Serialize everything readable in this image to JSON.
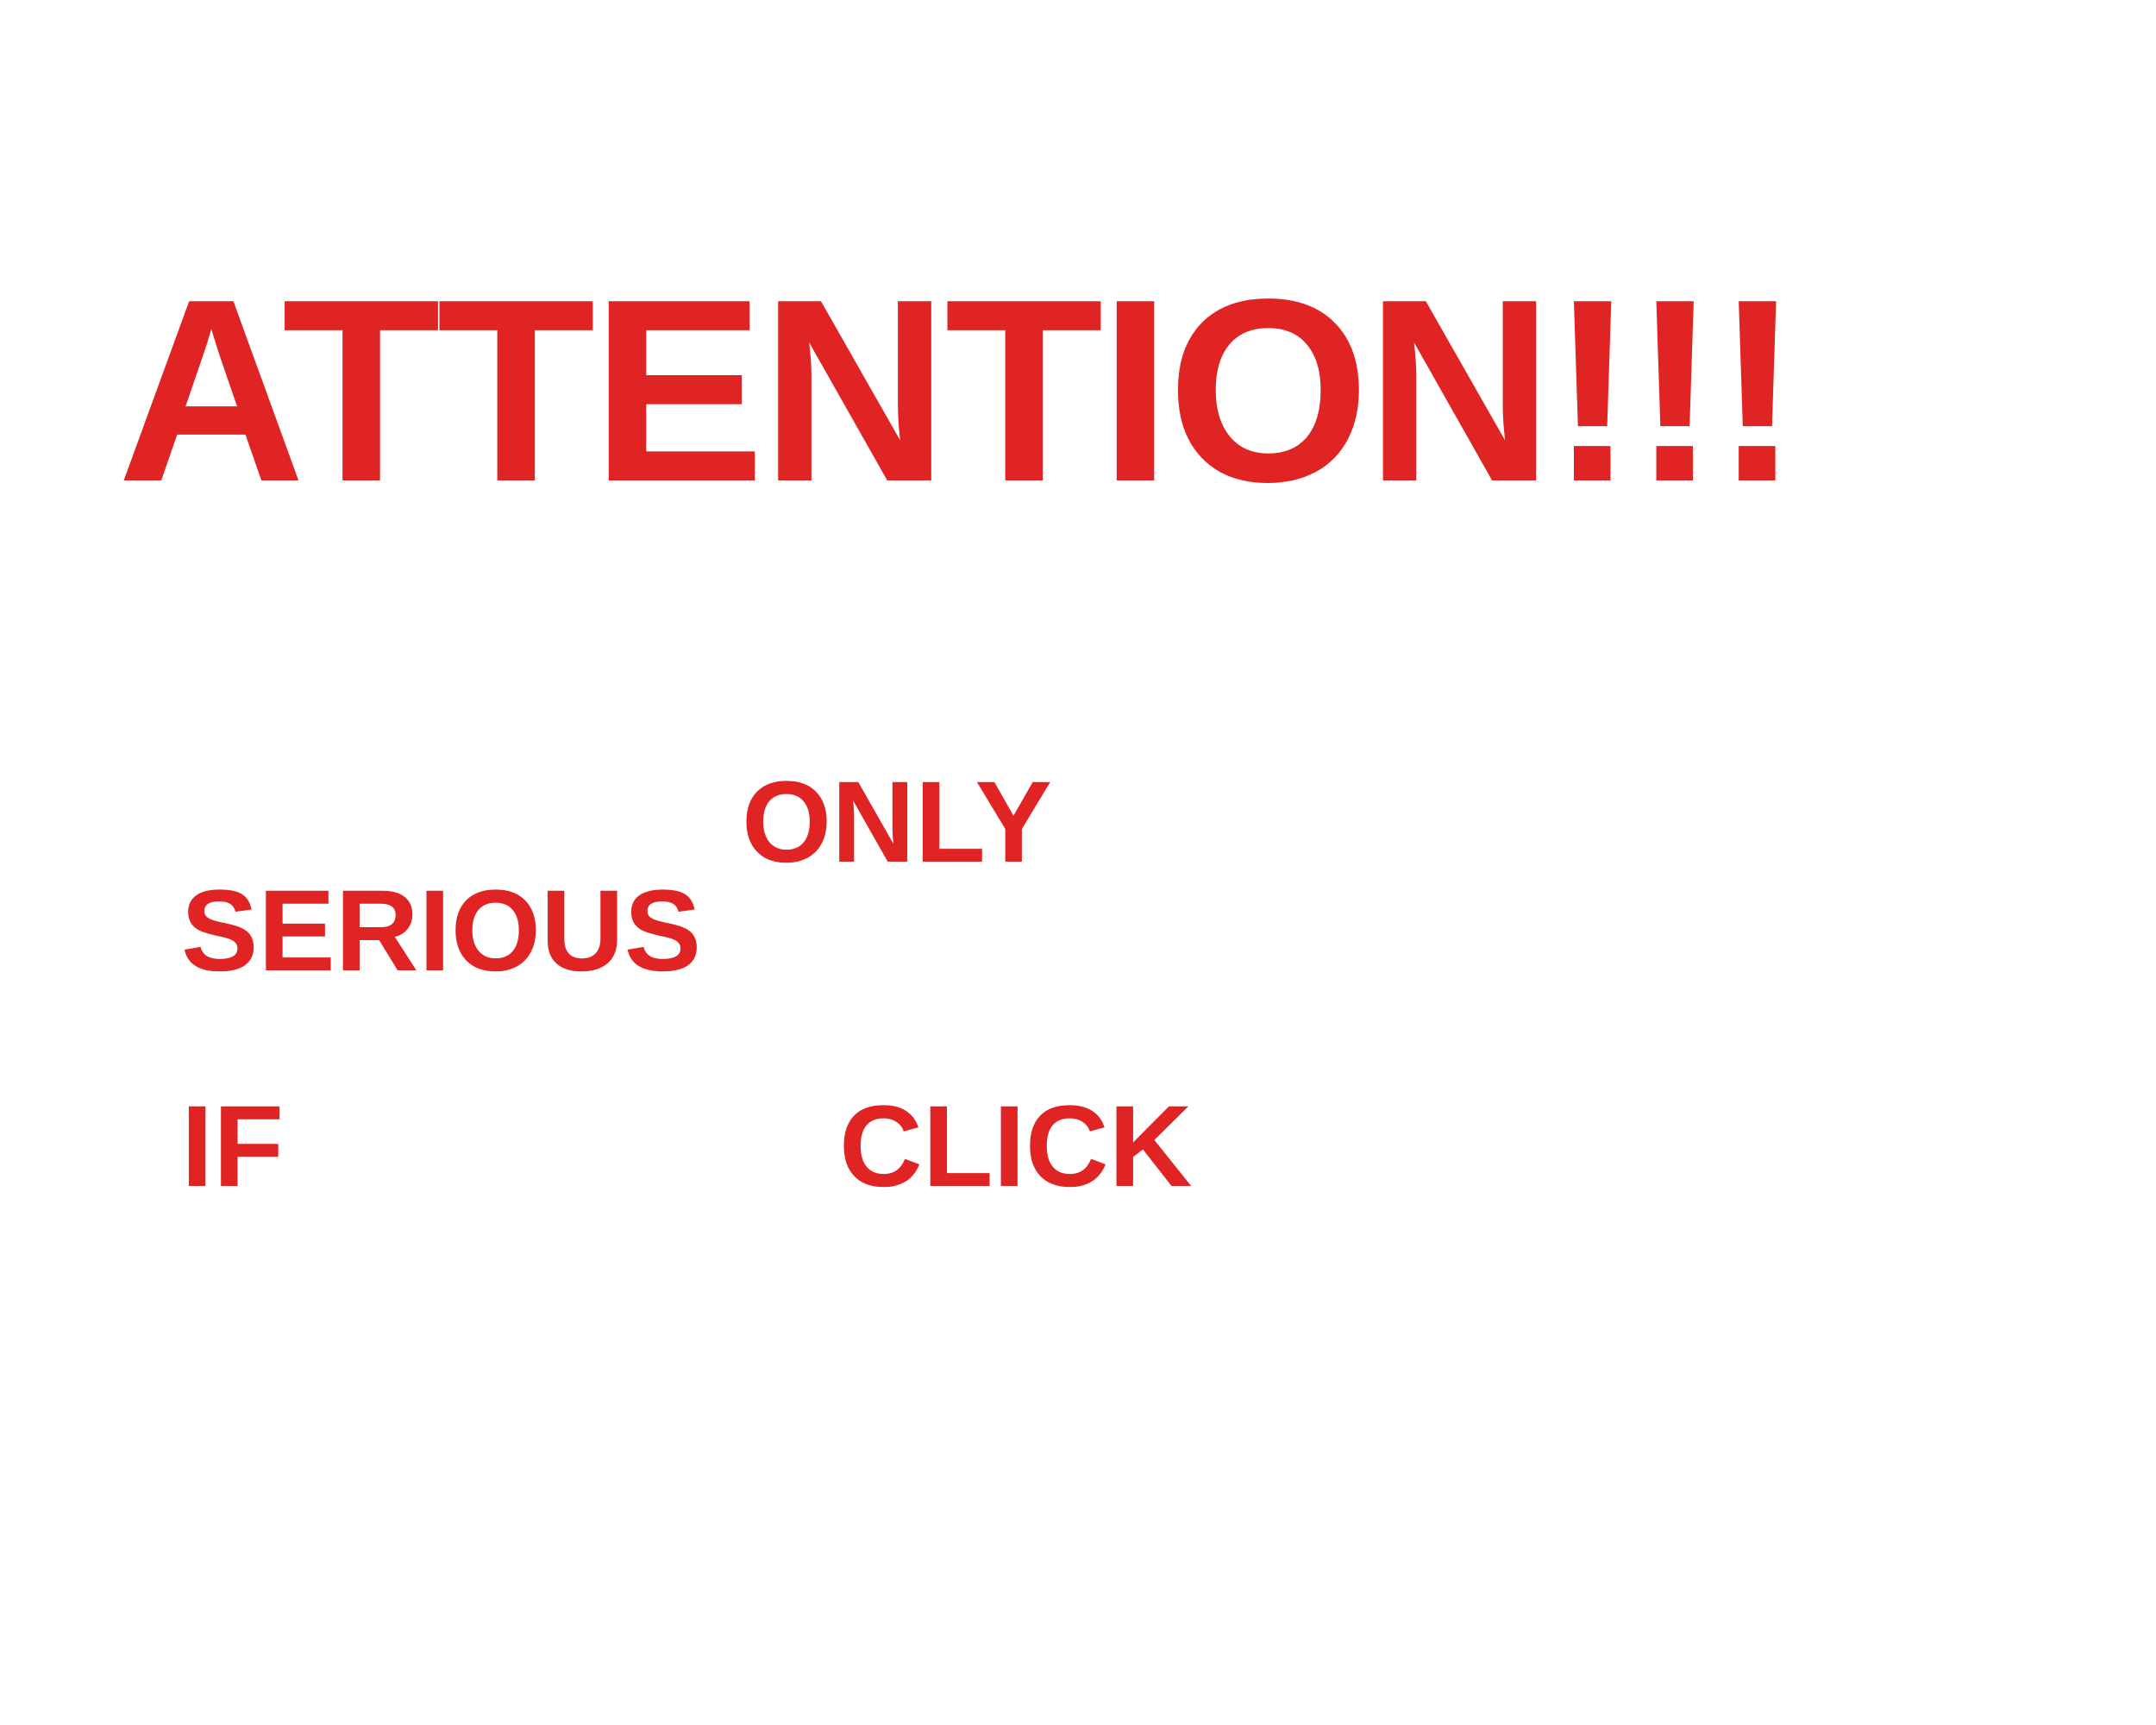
{
  "headline": "ATTENTION!!!",
  "words": {
    "only": "ONLY",
    "serious": "SERIOUS",
    "if": "IF",
    "click": "CLICK"
  },
  "colors": {
    "text": "#e02424",
    "background": "#ffffff"
  }
}
